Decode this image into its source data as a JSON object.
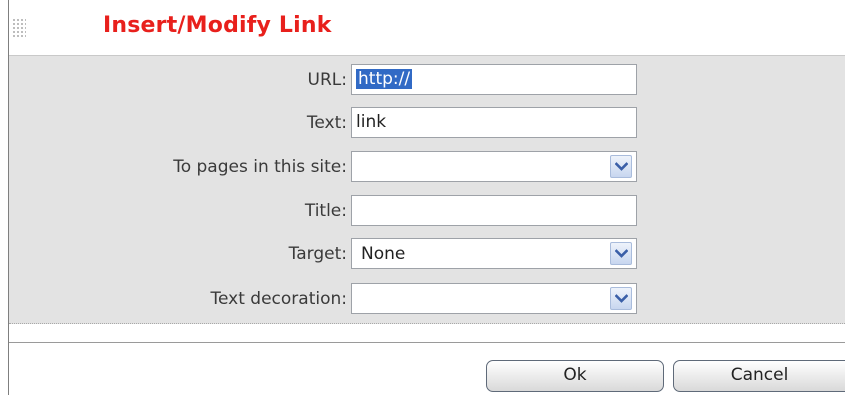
{
  "dialog": {
    "title": "Insert/Modify Link"
  },
  "form": {
    "url": {
      "label": "URL:",
      "value": "http://"
    },
    "text": {
      "label": "Text:",
      "value": "link"
    },
    "pages": {
      "label": "To pages in this site:",
      "value": ""
    },
    "title": {
      "label": "Title:",
      "value": ""
    },
    "target": {
      "label": "Target:",
      "value": "None"
    },
    "decoration": {
      "label": "Text decoration:",
      "value": ""
    }
  },
  "buttons": {
    "ok": "Ok",
    "cancel": "Cancel"
  },
  "icons": {
    "dropdown": "chevron-down-icon",
    "grip": "drag-grip-icon"
  },
  "colors": {
    "title": "#e8201c",
    "panel": "#e3e3e3",
    "selection": "#316ac5",
    "dropdown_arrow": "#3a5fa8"
  }
}
